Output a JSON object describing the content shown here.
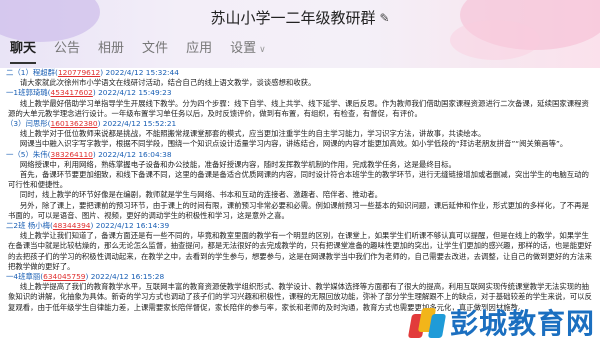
{
  "window": {
    "title": "苏山小学一二年级教研群",
    "edit_icon": "edit-pencil-icon"
  },
  "tabs": [
    {
      "label": "聊天",
      "active": true
    },
    {
      "label": "公告"
    },
    {
      "label": "相册"
    },
    {
      "label": "文件"
    },
    {
      "label": "应用"
    },
    {
      "label": "设置"
    }
  ],
  "messages": [
    {
      "prefix": "二（1）程超群(",
      "qq": "120779612",
      "time": ") 2022/4/12 15:32:44",
      "body": [
        "请大家就此次徐州市小学语文在线研讨活动，结合自己的线上语文教学，谈谈感想和收获。"
      ]
    },
    {
      "prefix": "一1班郭琦璐(",
      "qq": "453417602",
      "time": ") 2022/4/12 15:49:23",
      "body": [
        "线上教学最好借助学习单指导学生开展线下教学。分为四个步骤：线下自学、线上共学、线下延学、课后反思。作为教师我们借助国家课程资源进行二次备课，延续国家课程资源的大单元教学理念进行设计。一年级布置学习单任务以后，及时反馈评价，做到有布置，有组织，有检查，有督促，有评价。"
      ]
    },
    {
      "prefix": "（3）闫思彤(",
      "qq": "1601362380",
      "time": ") 2022/4/12 15:52:21",
      "body": [
        "线上教学对于低位教师来说都是挑战，不能照搬常规课堂那套的模式，应当更加注重学生的自主学习能力，学习识字方法，讲故事，共读绘本。",
        "网课当中融入识字写字教学，根据不同学段，围绕一个知识点设计适量学习内容，讲练结合，网课的内容才能更加高效。如小学低段的“拜访老朋友拼音”“阅关策画等”。"
      ]
    },
    {
      "prefix": "一（5）朱伟(",
      "qq": "383264110",
      "time": ") 2022/4/12 16:04:38",
      "body": [
        "网络授课中，利用网络，熟练掌握电子设备和办公技能，准备好授课内容，随时发挥教学机制的作用，完成教学任务，这是最终目标。",
        "首先，备课环节要更加细致，和线下备课不同，这里的备课是备适合优质网课的内容，同时设计符合本班学生的教学环节，进行无缝链接增加或者删减，突出学生的电脑互动的可行性和便捷性。",
        "同时，线上教学的环节好像是在编剧，教师就是学生与网络、书本和互动的连接者、激趣者、陪伴者、推动者。",
        "另外，除了课上，要把课前的预习环节，由于课上的时间有限，课前预习非常必要和必需。例如课前预习一些基本的知识问题，课后延伸和作业，形式更加的多样化，了不再是书面的，可以是语音、图片、视频，更好的调动学生的积极性和学习，这是意外之喜。"
      ]
    },
    {
      "prefix": "二2班 杨小梅(",
      "qq": "48344394",
      "time": ") 2022/4/12 16:14:39",
      "body": [
        "线上教学让我们知道了，备课方面还是有一些不同的，毕竟和教室里面的教学有一个明显的区别，在课堂上，如果学生们听课不够认真可以提醒，但是在线上的教学，如果学生在备课当中就是比较枯燥的，那么无论怎么监督，抽查提问，都是无法很好的去完成教学的，只有把课堂准备的趣味性更加的突出，让学生们更加的感兴趣，那样的话，也是能更好的去把孩子们的学习的积极性调动起来，在教学之中，去看到的学生参与，想要参与，这是在网课教学当中我们作为老师的，自己需要去改进，去调整，让自己的做到更好的方法来把教学做的更好了。"
      ]
    },
    {
      "prefix": "一4班章丽(",
      "qq": "634045759",
      "time": ") 2022/4/12 16:15:28",
      "body": [
        "线上教学提高了我们的教育教学水平，互联网丰富的教育资源使教学组织形式、教学设计、教学媒体选择等方面都有了很大的提高，利用互联网实现传统课堂教学无法实现的抽象知识的讲解，化抽象为具体。新奇的学习方式也调动了孩子们的学习兴趣和积极性，课程的无限回放功能，弥补了部分学生理解跟不上的缺点，对于基础较差的学生来说，可以反复观看，由于低年级学生自律能力差，上课需要家长陪伴督促，家长陪伴的参与率，家长和老师的及时沟通，教育方式也需要更加多元化，真正做到因材施教。"
      ]
    }
  ],
  "watermark": {
    "text": "彭城教育网"
  }
}
